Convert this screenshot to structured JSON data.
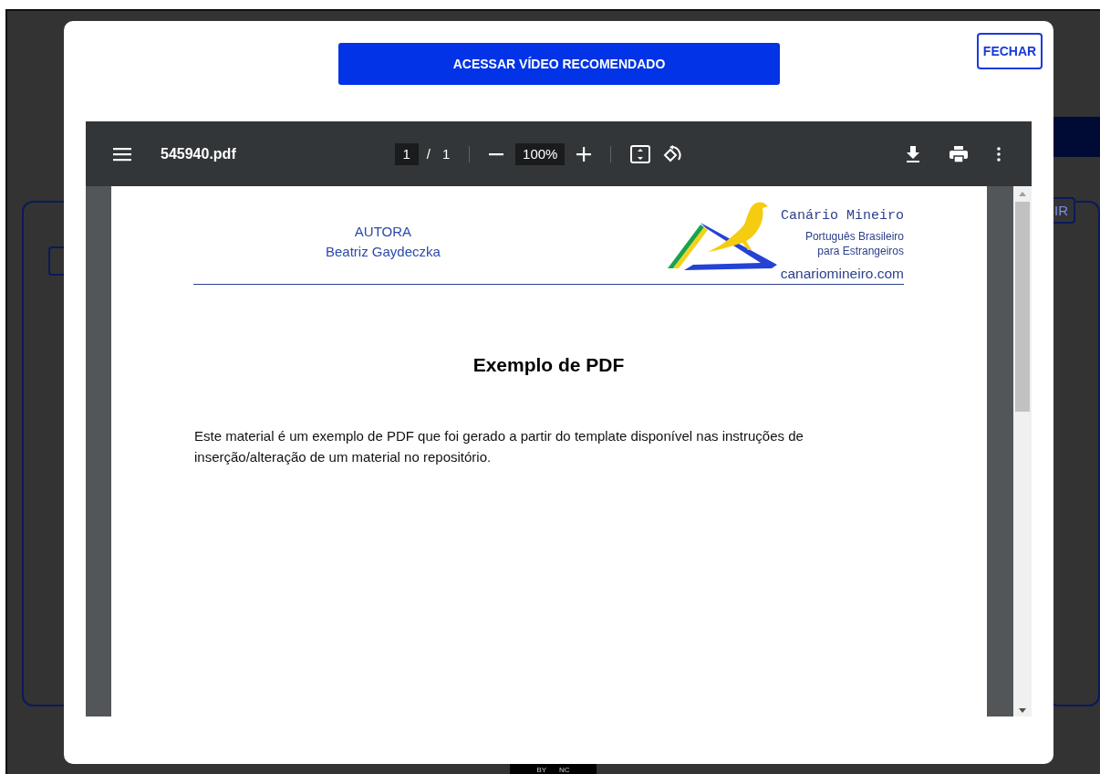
{
  "video_button": {
    "label": "ACESSAR VÍDEO RECOMENDADO"
  },
  "close_button": {
    "label": "FECHAR"
  },
  "pdf_viewer": {
    "file_name": "545940.pdf",
    "page_current": "1",
    "page_separator": "/",
    "page_total": "1",
    "zoom": "100%",
    "document": {
      "author_label": "AUTORA",
      "author_name": "Beatriz Gaydeczka",
      "brand_name": "Canário Mineiro",
      "brand_tagline": "Português Brasileiro",
      "brand_tagline_2": "para Estrangeiros",
      "brand_site": "canariomineiro.com",
      "title": "Exemplo de PDF",
      "body": "Este material é um exemplo de PDF que foi gerado a partir do template disponível nas instruções de inserção/alteração de um material no repositório."
    }
  },
  "background": {
    "button_label": "IR",
    "badge_labels": [
      "BY",
      "NC"
    ]
  }
}
